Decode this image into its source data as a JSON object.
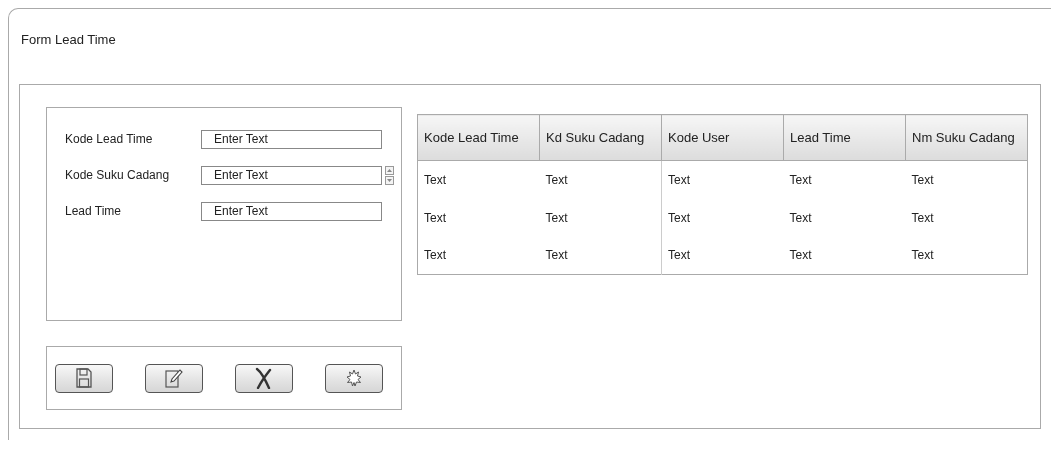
{
  "window": {
    "title": "Form Lead Time"
  },
  "fields": [
    {
      "label": "Kode Lead Time",
      "placeholder": "Enter Text",
      "kind": "text"
    },
    {
      "label": "Kode Suku Cadang",
      "placeholder": "Enter Text",
      "kind": "spinner"
    },
    {
      "label": "Lead Time",
      "placeholder": "Enter Text",
      "kind": "text"
    }
  ],
  "toolbar": [
    {
      "kind": "save"
    },
    {
      "kind": "edit"
    },
    {
      "kind": "delete"
    },
    {
      "kind": "new"
    }
  ],
  "table": {
    "columns": [
      "Kode Lead Time",
      "Kd Suku Cadang",
      "Kode User",
      "Lead Time",
      "Nm Suku Cadang"
    ],
    "rows": [
      [
        "Text",
        "Text",
        "Text",
        "Text",
        "Text"
      ],
      [
        "Text",
        "Text",
        "Text",
        "Text",
        "Text"
      ],
      [
        "Text",
        "Text",
        "Text",
        "Text",
        "Text"
      ]
    ]
  }
}
